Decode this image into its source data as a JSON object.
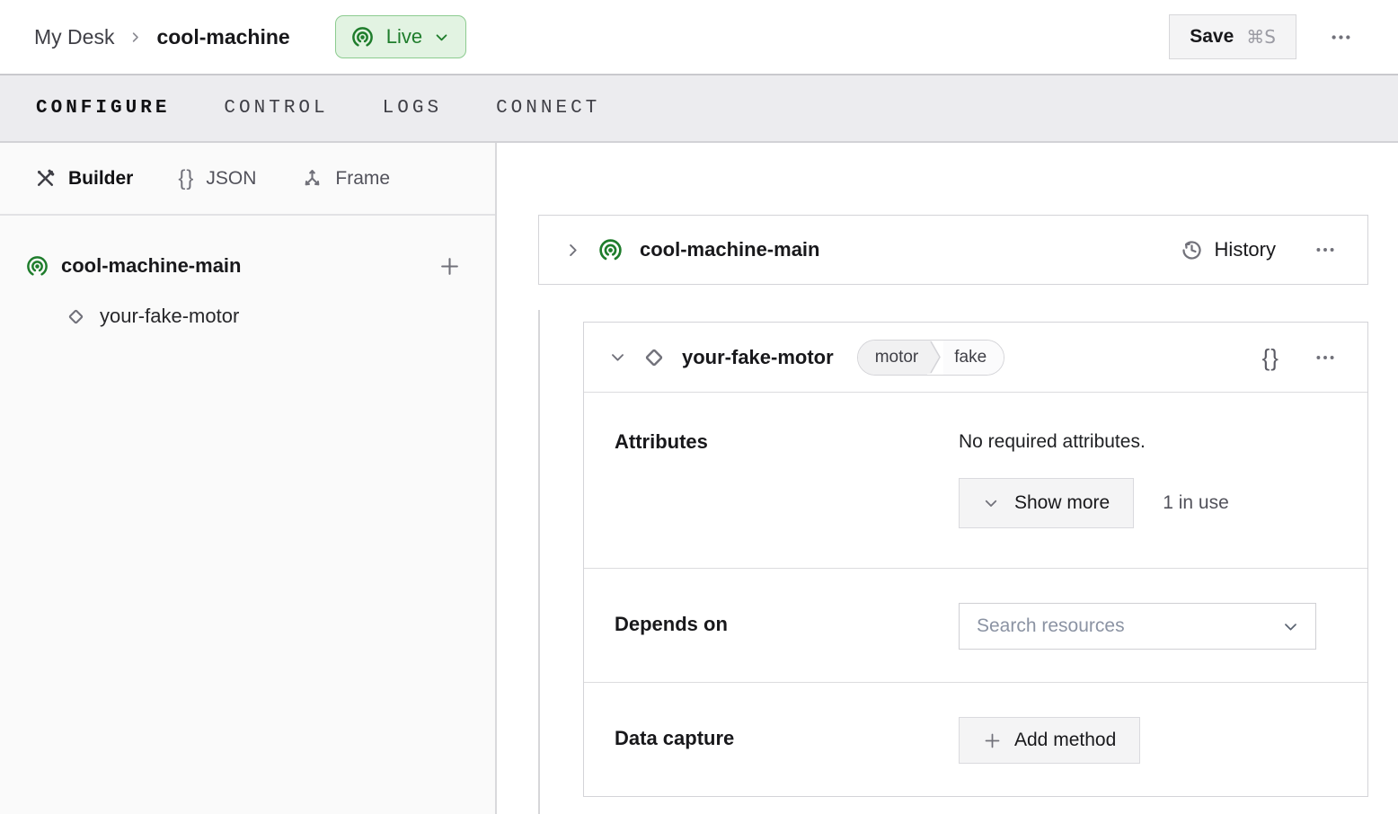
{
  "header": {
    "breadcrumb": {
      "parent": "My Desk",
      "current": "cool-machine"
    },
    "status": {
      "label": "Live"
    },
    "save": {
      "label": "Save",
      "shortcut": "⌘S"
    }
  },
  "tabs": [
    {
      "label": "CONFIGURE",
      "active": true
    },
    {
      "label": "CONTROL",
      "active": false
    },
    {
      "label": "LOGS",
      "active": false
    },
    {
      "label": "CONNECT",
      "active": false
    }
  ],
  "sidebar": {
    "views": [
      {
        "label": "Builder",
        "icon": "hammer-wrench-icon",
        "active": true
      },
      {
        "label": "JSON",
        "icon": "braces-icon",
        "active": false
      },
      {
        "label": "Frame",
        "icon": "axes-icon",
        "active": false
      }
    ],
    "json_glyph": "{}",
    "tree": [
      {
        "label": "cool-machine-main",
        "icon": "broadcast-icon"
      },
      {
        "label": "your-fake-motor",
        "icon": "diamond-icon"
      }
    ]
  },
  "main": {
    "part_card": {
      "title": "cool-machine-main",
      "history_label": "History"
    },
    "resource_card": {
      "title": "your-fake-motor",
      "badges": [
        "motor",
        "fake"
      ],
      "braces_glyph": "{}",
      "attributes": {
        "label": "Attributes",
        "empty_text": "No required attributes.",
        "show_more_label": "Show more",
        "in_use_text": "1 in use"
      },
      "depends_on": {
        "label": "Depends on",
        "search_placeholder": "Search resources"
      },
      "data_capture": {
        "label": "Data capture",
        "add_method_label": "Add method"
      }
    }
  },
  "colors": {
    "accent_green": "#1f7d2c",
    "live_badge_bg": "#e2f3e2",
    "live_badge_border": "#8ccb8f",
    "tabbar_bg": "#ececef",
    "sidebar_bg": "#fafafa",
    "border_gray": "#d4d4d8",
    "secondary_text": "#52525b",
    "placeholder_text": "#8b93a3"
  }
}
